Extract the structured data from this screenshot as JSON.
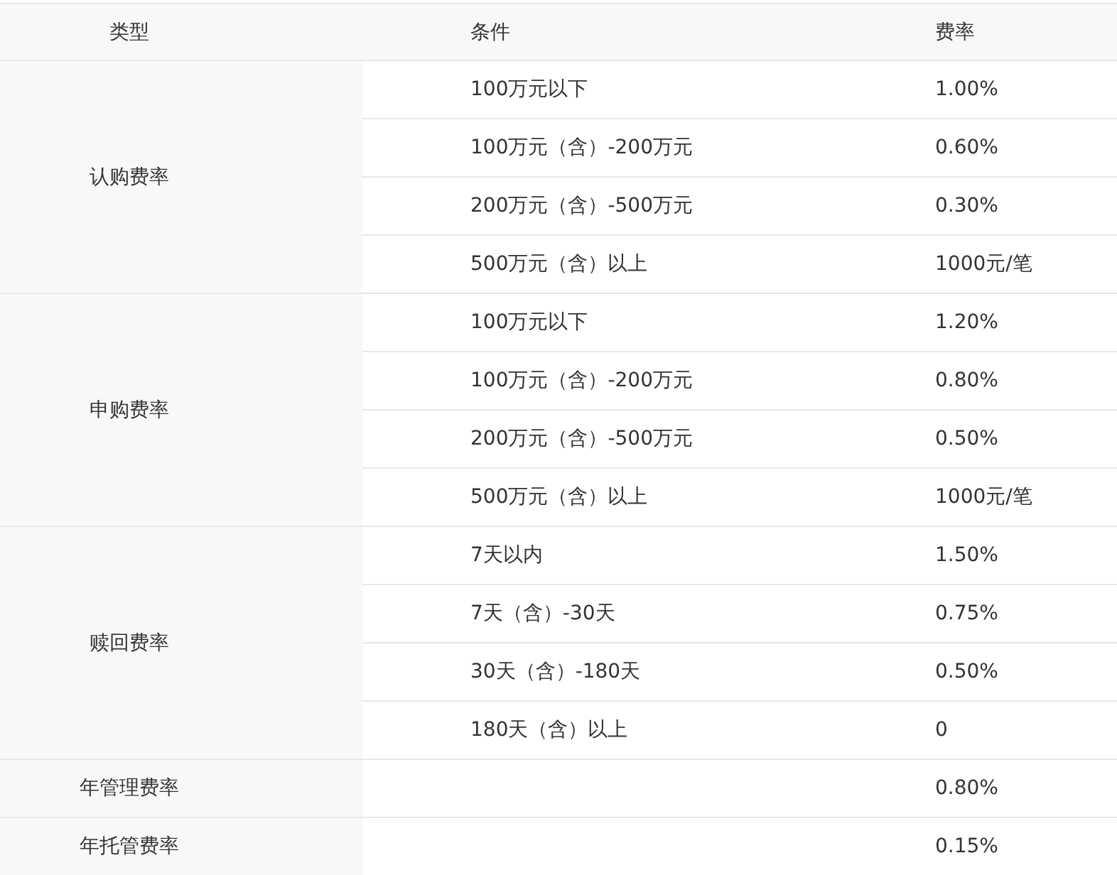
{
  "table": {
    "columns": [
      "类型",
      "条件",
      "费率"
    ],
    "groups": [
      {
        "type": "认购费率",
        "rows": [
          {
            "condition": "100万元以下",
            "rate": "1.00%"
          },
          {
            "condition": "100万元（含）-200万元",
            "rate": "0.60%"
          },
          {
            "condition": "200万元（含）-500万元",
            "rate": "0.30%"
          },
          {
            "condition": "500万元（含）以上",
            "rate": "1000元/笔"
          }
        ]
      },
      {
        "type": "申购费率",
        "rows": [
          {
            "condition": "100万元以下",
            "rate": "1.20%"
          },
          {
            "condition": "100万元（含）-200万元",
            "rate": "0.80%"
          },
          {
            "condition": "200万元（含）-500万元",
            "rate": "0.50%"
          },
          {
            "condition": "500万元（含）以上",
            "rate": "1000元/笔"
          }
        ]
      },
      {
        "type": "赎回费率",
        "rows": [
          {
            "condition": "7天以内",
            "rate": "1.50%"
          },
          {
            "condition": "7天（含）-30天",
            "rate": "0.75%"
          },
          {
            "condition": "30天（含）-180天",
            "rate": "0.50%"
          },
          {
            "condition": "180天（含）以上",
            "rate": "0"
          }
        ]
      },
      {
        "type": "年管理费率",
        "rows": [
          {
            "rate": "0.80%"
          }
        ]
      },
      {
        "type": "年托管费率",
        "rows": [
          {
            "rate": "0.15%"
          }
        ]
      }
    ]
  }
}
